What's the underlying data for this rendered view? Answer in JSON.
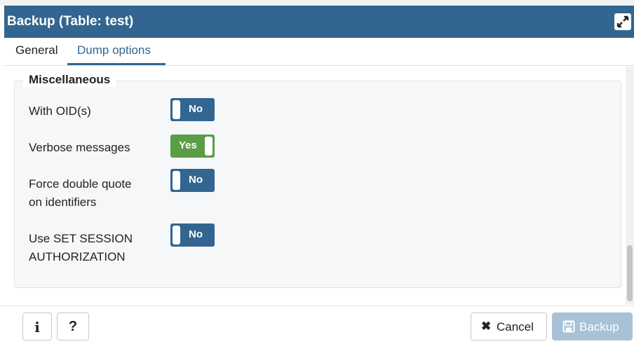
{
  "dialog": {
    "title": "Backup (Table: test)"
  },
  "tabs": [
    {
      "label": "General"
    },
    {
      "label": "Dump options"
    }
  ],
  "section": {
    "legend": "Miscellaneous",
    "rows": [
      {
        "label_lines": [
          "With OID(s)"
        ],
        "value": "No",
        "state": "off"
      },
      {
        "label_lines": [
          "Verbose messages"
        ],
        "value": "Yes",
        "state": "on"
      },
      {
        "label_lines": [
          "Force double quote",
          "on identifiers"
        ],
        "value": "No",
        "state": "off"
      },
      {
        "label_lines": [
          "Use SET SESSION",
          "AUTHORIZATION"
        ],
        "value": "No",
        "state": "off"
      }
    ]
  },
  "footer": {
    "info_glyph": "i",
    "help_glyph": "?",
    "cancel_icon": "✖",
    "cancel_label": "Cancel",
    "backup_label": "Backup"
  },
  "colors": {
    "titlebar": "#326690",
    "toggle_off": "#326690",
    "toggle_on": "#5b9c47",
    "backup_disabled": "#a8c1d7"
  },
  "icons": {
    "expand": "expand-icon",
    "info": "info-icon",
    "help": "help-icon",
    "cancel": "close-icon",
    "backup": "save-icon"
  }
}
